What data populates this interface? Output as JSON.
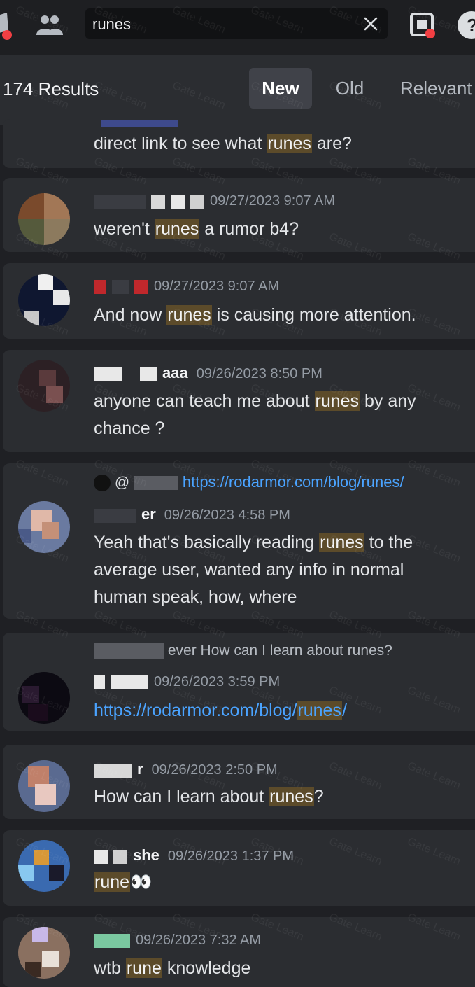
{
  "search": {
    "query": "runes"
  },
  "results": {
    "count_label": "174 Results"
  },
  "sort_tabs": [
    {
      "label": "New",
      "active": true
    },
    {
      "label": "Old",
      "active": false
    },
    {
      "label": "Relevant",
      "active": false
    }
  ],
  "messages": [
    {
      "text_parts": [
        "direct link to see what ",
        "runes",
        " are?"
      ]
    },
    {
      "timestamp": "09/27/2023 9:07 AM",
      "text_parts": [
        "weren't ",
        "runes",
        " a rumor b4?"
      ]
    },
    {
      "timestamp": "09/27/2023 9:07 AM",
      "text_parts": [
        "And now ",
        "runes",
        " is causing more attention."
      ]
    },
    {
      "author_fragment": "aaa",
      "timestamp": "09/26/2023 8:50 PM",
      "line1_parts": [
        "anyone can teach me about ",
        "runes",
        " by any"
      ],
      "line2": "chance ?"
    },
    {
      "reply_prefix": "@",
      "reply_link": "https://rodarmor.com/blog/runes/",
      "author_fragment": "er",
      "timestamp": "09/26/2023 4:58 PM",
      "line1_parts": [
        "Yeah that's basically reading ",
        "runes",
        " to the"
      ],
      "line2": "average user, wanted any info in normal",
      "line3": "human speak, how, where"
    },
    {
      "reply_text": "ever How can I learn about runes?",
      "timestamp": "09/26/2023 3:59 PM",
      "link_parts": [
        "https://rodarmor.com/blog/",
        "runes",
        "/"
      ]
    },
    {
      "author_fragment": "r",
      "timestamp": "09/26/2023 2:50 PM",
      "text_parts": [
        "How can I learn about ",
        "runes",
        "?"
      ]
    },
    {
      "author_fragment": "she",
      "timestamp": "09/26/2023 1:37 PM",
      "text_parts": [
        "rune",
        "👀"
      ]
    },
    {
      "timestamp": "09/26/2023 7:32 AM",
      "text_parts": [
        "wtb ",
        "rune",
        " knowledge"
      ]
    }
  ],
  "watermark": "Gate Learn",
  "colors": {
    "highlight": "#5c4b2a",
    "link": "#4aa3ff",
    "card": "#2b2d31",
    "page": "#1f2024"
  }
}
